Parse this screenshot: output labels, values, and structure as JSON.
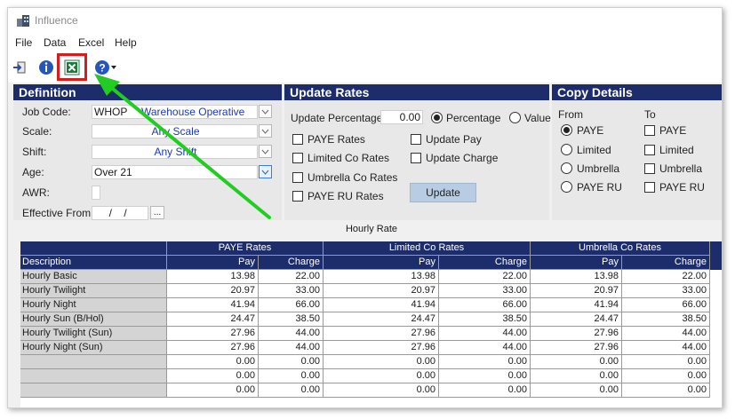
{
  "window": {
    "title": "Influence"
  },
  "menu": [
    "File",
    "Data",
    "Excel",
    "Help"
  ],
  "toolbar": {
    "icons": [
      "exit-icon",
      "info-icon",
      "excel-icon",
      "help-icon"
    ],
    "highlight_color": "#d11f1f",
    "arrow_color": "#22cc22"
  },
  "definition": {
    "header": "Definition",
    "job_code_label": "Job Code:",
    "job_code_value": "WHOP",
    "job_code_desc": "Warehouse Operative",
    "scale_label": "Scale:",
    "scale_value": "Any Scale",
    "shift_label": "Shift:",
    "shift_value": "Any Shift",
    "age_label": "Age:",
    "age_value": "Over 21",
    "awr_label": "AWR:",
    "effective_from_label": "Effective From:",
    "effective_from_value": "  /    /",
    "ellipsis": "..."
  },
  "update_rates": {
    "header": "Update Rates",
    "percentage_label": "Update Percentage:",
    "percentage_value": "0.00",
    "radio_percentage": "Percentage",
    "radio_value": "Value",
    "checks_left": [
      "PAYE Rates",
      "Limited Co Rates",
      "Umbrella Co Rates",
      "PAYE RU Rates"
    ],
    "checks_right": [
      "Update Pay",
      "Update Charge"
    ],
    "update_button": "Update"
  },
  "copy_details": {
    "header": "Copy Details",
    "from_label": "From",
    "to_label": "To",
    "from_options": [
      "PAYE",
      "Limited",
      "Umbrella",
      "PAYE RU"
    ],
    "to_options": [
      "PAYE",
      "Limited",
      "Umbrella",
      "PAYE RU"
    ]
  },
  "grid": {
    "caption": "Hourly Rate",
    "group_headers": [
      "PAYE Rates",
      "Limited Co Rates",
      "Umbrella Co Rates"
    ],
    "columns": [
      "Description",
      "Pay",
      "Charge",
      "Pay",
      "Charge",
      "Pay",
      "Charge"
    ],
    "rows": [
      [
        "Hourly Basic",
        "13.98",
        "22.00",
        "13.98",
        "22.00",
        "13.98",
        "22.00"
      ],
      [
        "Hourly Twilight",
        "20.97",
        "33.00",
        "20.97",
        "33.00",
        "20.97",
        "33.00"
      ],
      [
        "Hourly Night",
        "41.94",
        "66.00",
        "41.94",
        "66.00",
        "41.94",
        "66.00"
      ],
      [
        "Hourly Sun (B/Hol)",
        "24.47",
        "38.50",
        "24.47",
        "38.50",
        "24.47",
        "38.50"
      ],
      [
        "Hourly Twilight (Sun)",
        "27.96",
        "44.00",
        "27.96",
        "44.00",
        "27.96",
        "44.00"
      ],
      [
        "Hourly Night (Sun)",
        "27.96",
        "44.00",
        "27.96",
        "44.00",
        "27.96",
        "44.00"
      ],
      [
        "",
        "0.00",
        "0.00",
        "0.00",
        "0.00",
        "0.00",
        "0.00"
      ],
      [
        "",
        "0.00",
        "0.00",
        "0.00",
        "0.00",
        "0.00",
        "0.00"
      ],
      [
        "",
        "0.00",
        "0.00",
        "0.00",
        "0.00",
        "0.00",
        "0.00"
      ]
    ]
  }
}
